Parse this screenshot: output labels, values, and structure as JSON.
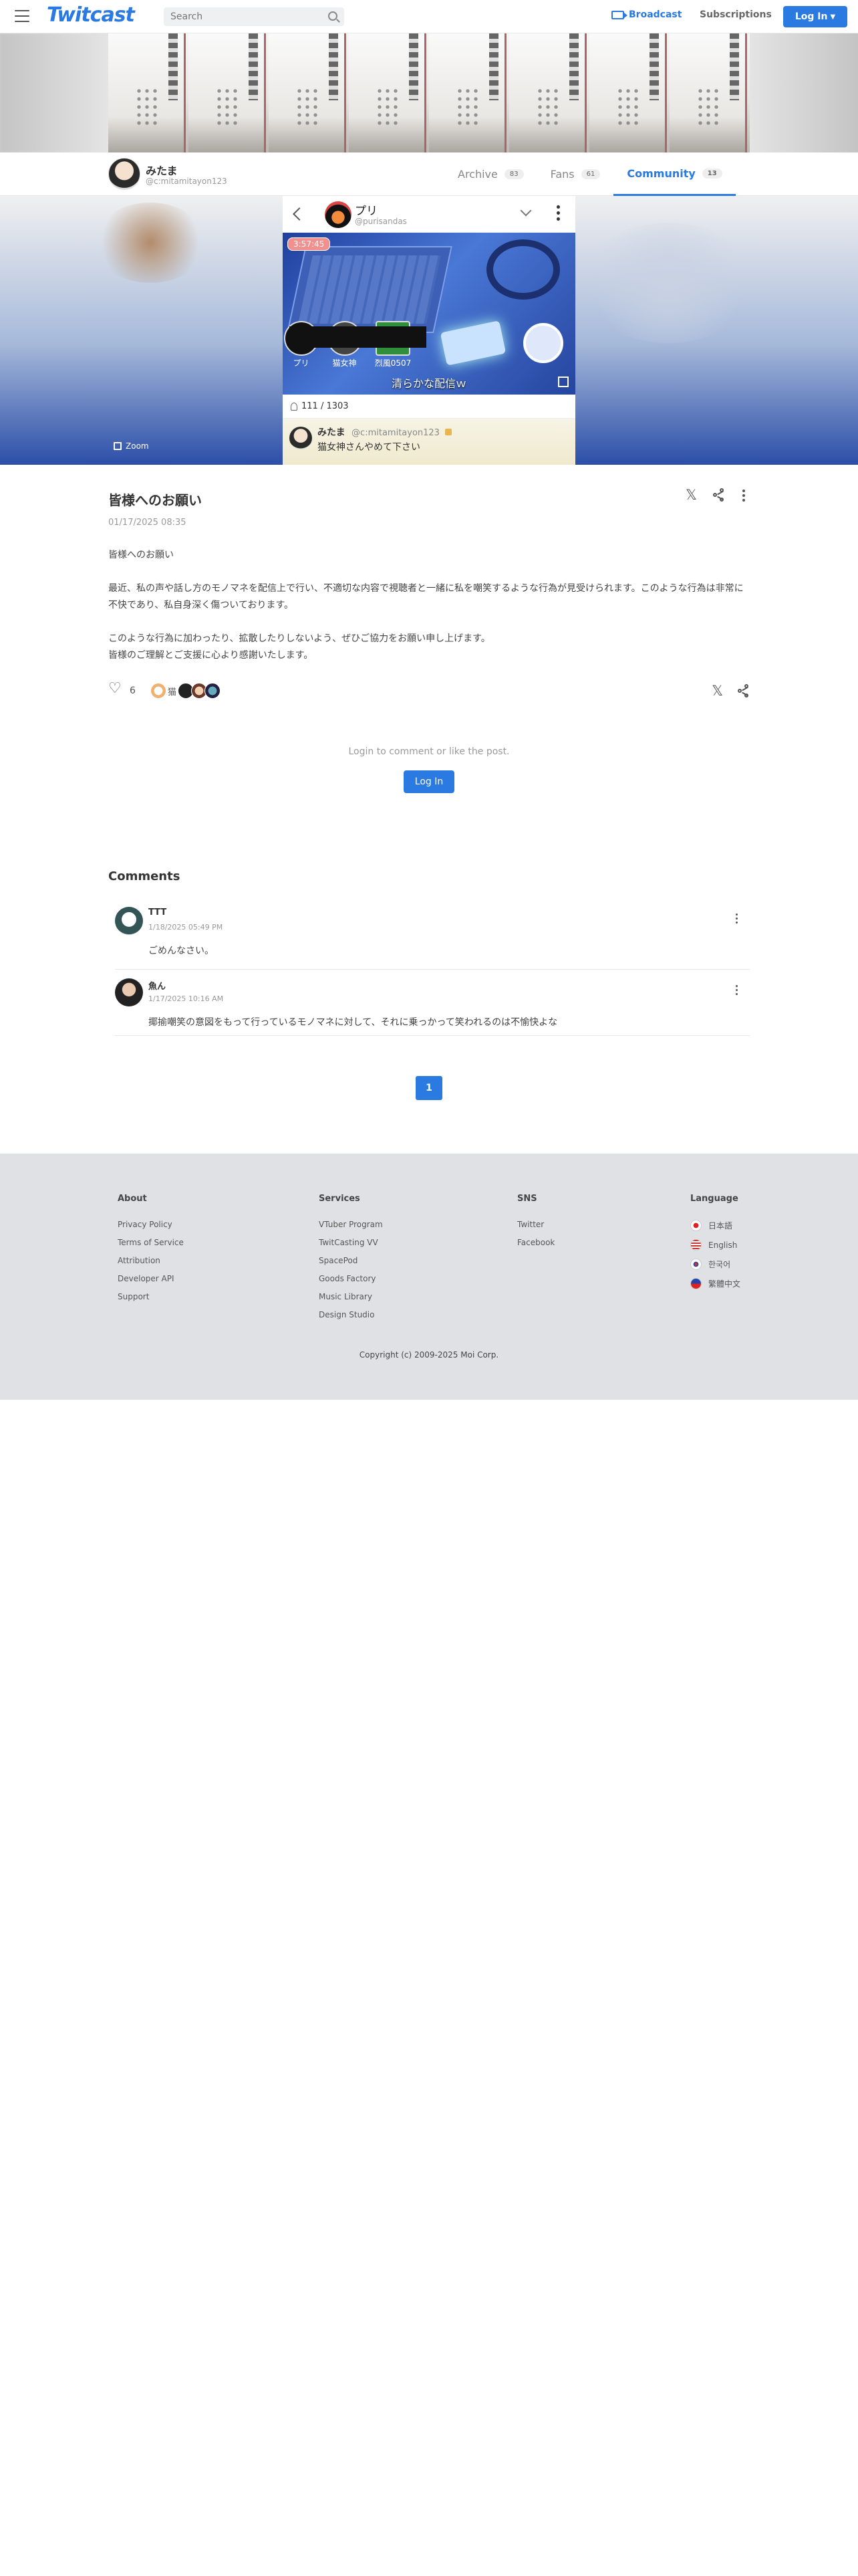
{
  "header": {
    "logo": "Twitcast",
    "search_placeholder": "Search",
    "broadcast_label": "Broadcast",
    "subscriptions_label": "Subscriptions",
    "login_label": "Log In"
  },
  "profile": {
    "name": "みたま",
    "id": "@c:mitamitayon123",
    "tabs": [
      {
        "label": "Archive",
        "count": "83"
      },
      {
        "label": "Fans",
        "count": "61"
      },
      {
        "label": "Community",
        "count": "13"
      }
    ]
  },
  "player": {
    "streamer_name": "プリ",
    "streamer_id": "@purisandas",
    "timer": "3:57:45",
    "viewers": [
      {
        "name": "プリ"
      },
      {
        "name": "猫女神"
      },
      {
        "name": "烈風0507"
      }
    ],
    "caption": "清らかな配信ｗ",
    "viewer_count": "111 / 1303",
    "comment": {
      "name": "みたま",
      "id": "@c:mitamitayon123",
      "text": "猫女神さんやめて下さい"
    },
    "zoom_label": "Zoom"
  },
  "post": {
    "title": "皆様へのお願い",
    "date": "01/17/2025 08:35",
    "paragraphs": [
      "皆様へのお願い",
      "",
      "最近、私の声や話し方のモノマネを配信上で行い、不適切な内容で視聴者と一緒に私を嘲笑するような行為が見受けられます。このような行為は非常に不快であり、私自身深く傷ついております。",
      "",
      "このような行為に加わったり、拡散したりしないよう、ぜひご協力をお願い申し上げます。",
      "皆様のご理解とご支援に心より感謝いたします。"
    ],
    "like_count": "6",
    "liker_name": "猫",
    "login_prompt": "Login to comment or like the post.",
    "login_button": "Log In"
  },
  "comments": {
    "heading": "Comments",
    "items": [
      {
        "name": "TTT",
        "date": "1/18/2025 05:49 PM",
        "text": "ごめんなさい。"
      },
      {
        "name": "魚ん",
        "date": "1/17/2025 10:16 AM",
        "text": "揶揄嘲笑の意図をもって行っているモノマネに対して、それに乗っかって笑われるのは不愉快よな"
      }
    ],
    "page": "1"
  },
  "footer": {
    "about": {
      "heading": "About",
      "links": [
        "Privacy Policy",
        "Terms of Service",
        "Attribution",
        "Developer API",
        "Support"
      ]
    },
    "services": {
      "heading": "Services",
      "links": [
        "VTuber Program",
        "TwitCasting VV",
        "SpacePod",
        "Goods Factory",
        "Music Library",
        "Design Studio"
      ]
    },
    "sns": {
      "heading": "SNS",
      "links": [
        "Twitter",
        "Facebook"
      ]
    },
    "language": {
      "heading": "Language",
      "links": [
        "日本語",
        "English",
        "한국어",
        "繁體中文"
      ]
    },
    "copyright": "Copyright (c) 2009-2025 Moi Corp."
  },
  "colors": {
    "accent": "#2a7ae2",
    "footer_bg": "#dfe1e4"
  }
}
